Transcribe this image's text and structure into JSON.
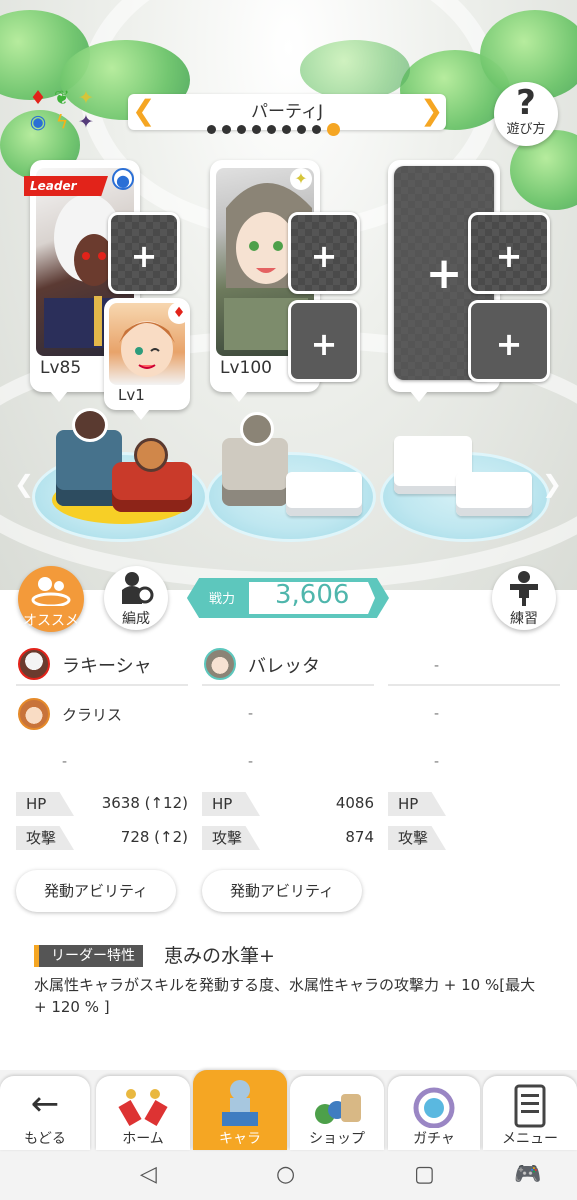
{
  "party": {
    "title": "パーティJ",
    "page_count": 9,
    "active_page": 9
  },
  "help": {
    "label": "遊び方"
  },
  "leader_badge": "Leader",
  "cards": [
    {
      "main_level": "Lv85",
      "sub_level": "Lv1"
    },
    {
      "main_level": "Lv100"
    },
    {}
  ],
  "plus_symbol": "+",
  "buttons": {
    "recommend": "オススメ",
    "formation": "編成",
    "practice": "練習"
  },
  "power": {
    "label": "戦力",
    "value": "3,606"
  },
  "columns": [
    {
      "main": "ラキーシャ",
      "sub": "クラリス",
      "extra": "-",
      "hp": "3638 (↑12)",
      "atk": "728 (↑2)",
      "ability": "発動アビリティ"
    },
    {
      "main": "バレッタ",
      "sub": "-",
      "extra": "-",
      "hp": "4086",
      "atk": "874",
      "ability": "発動アビリティ"
    },
    {
      "main": "-",
      "sub": "-",
      "extra": "-"
    }
  ],
  "stat_labels": {
    "hp": "HP",
    "atk": "攻撃"
  },
  "leader": {
    "tag": "リーダー特性",
    "name": "恵みの水筆+",
    "desc": "水属性キャラがスキルを発動する度、水属性キャラの攻撃力 + 10 %[最大 + 120 % ]"
  },
  "nav": [
    {
      "label": "もどる",
      "icon": "back-arrow-icon"
    },
    {
      "label": "ホーム",
      "icon": "home-icon"
    },
    {
      "label": "キャラ",
      "icon": "chara-icon",
      "active": true
    },
    {
      "label": "ショップ",
      "icon": "shop-icon"
    },
    {
      "label": "ガチャ",
      "icon": "gacha-icon"
    },
    {
      "label": "メニュー",
      "icon": "menu-icon"
    }
  ],
  "colors": {
    "accent": "#f5a623",
    "power_teal": "#5dc7bd",
    "leader_red": "#e2231a"
  }
}
